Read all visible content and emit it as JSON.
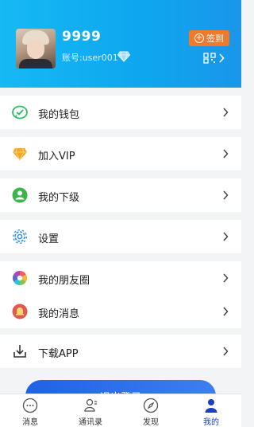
{
  "profile": {
    "username": "9999",
    "account_label": "账号:user001",
    "signin_label": "签到"
  },
  "menu": {
    "wallet": "我的钱包",
    "vip": "加入VIP",
    "subordinates": "我的下级",
    "settings": "设置",
    "moments": "我的朋友圈",
    "messages": "我的消息",
    "download": "下载APP"
  },
  "logout_label": "退出登录",
  "tabs": [
    {
      "label": "消息"
    },
    {
      "label": "通讯录"
    },
    {
      "label": "发现"
    },
    {
      "label": "我的"
    }
  ],
  "colors": {
    "header": "#0ea6ef",
    "signin": "#f07a2a",
    "logout": "#1f62e6",
    "active_tab": "#1a3fbf"
  }
}
